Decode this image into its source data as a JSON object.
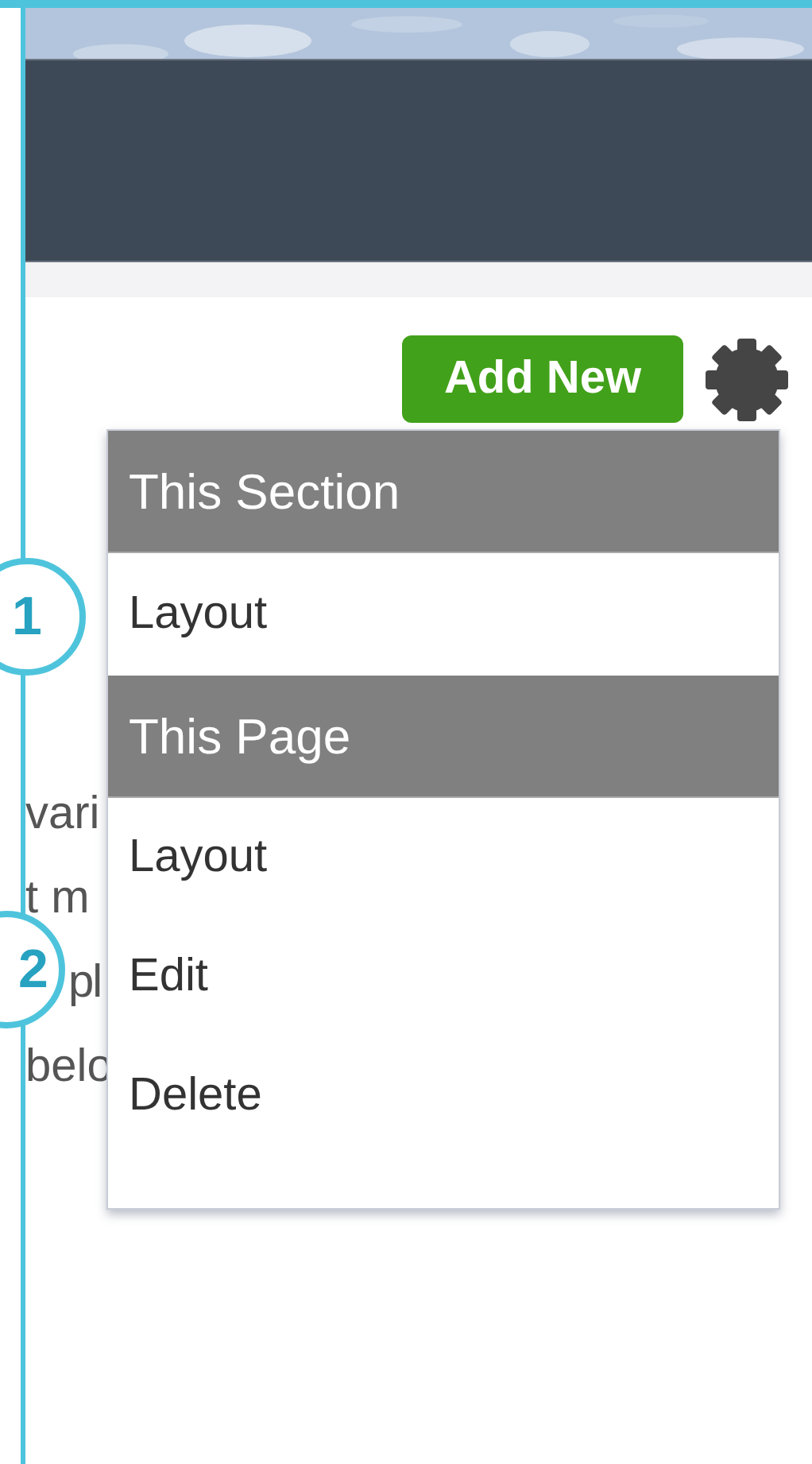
{
  "toolbar": {
    "add_button": "Add New"
  },
  "paragraph_lines": [
    {
      "segments": [
        "vari"
      ]
    },
    {
      "segments": [
        "t m"
      ]
    },
    {
      "segments": [
        "pl"
      ]
    },
    {
      "segments": [
        "belo"
      ]
    }
  ],
  "menu": {
    "sections": [
      {
        "title": "This Section",
        "items": [
          "Layout"
        ]
      },
      {
        "title": "This Page",
        "items": [
          "Layout",
          "Edit",
          "Delete"
        ]
      }
    ]
  },
  "markers": [
    {
      "label": "1"
    },
    {
      "label": "2"
    }
  ]
}
